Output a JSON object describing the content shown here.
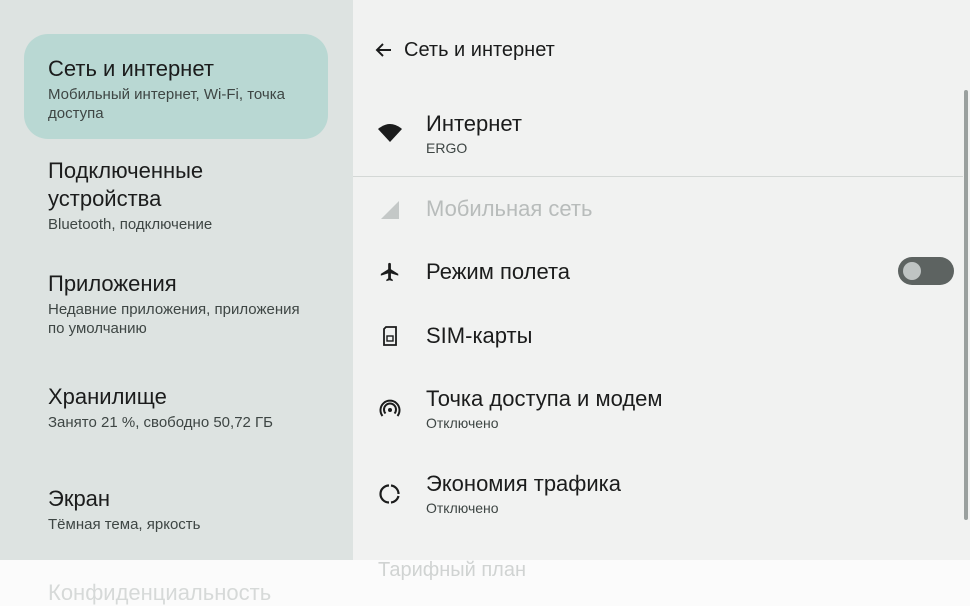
{
  "left_nav": {
    "items": [
      {
        "title": "Сеть и интернет",
        "subtitle": "Мобильный интернет, Wi-Fi, точка доступа"
      },
      {
        "title": "Подключенные устройства",
        "subtitle": "Bluetooth, подключение"
      },
      {
        "title": "Приложения",
        "subtitle": "Недавние приложения, приложения по умолчанию"
      },
      {
        "title": "Хранилище",
        "subtitle": "Занято 21 %, свободно 50,72 ГБ"
      },
      {
        "title": "Экран",
        "subtitle": "Тёмная тема, яркость"
      },
      {
        "title": "Конфиденциальность"
      }
    ]
  },
  "header": {
    "title": "Сеть и интернет"
  },
  "settings": {
    "internet": {
      "title": "Интернет",
      "subtitle": "ERGO",
      "icon": "wifi-icon"
    },
    "mobile": {
      "title": "Мобильная сеть",
      "icon": "signal-icon"
    },
    "airplane": {
      "title": "Режим полета",
      "icon": "airplane-icon",
      "toggle": "off"
    },
    "sim": {
      "title": "SIM-карты",
      "icon": "sim-card-icon"
    },
    "hotspot": {
      "title": "Точка доступа и модем",
      "subtitle": "Отключено",
      "icon": "hotspot-icon"
    },
    "datasaver": {
      "title": "Экономия трафика",
      "subtitle": "Отключено",
      "icon": "data-saver-icon"
    },
    "plan": {
      "title": "Тарифный план"
    }
  },
  "colors": {
    "left_bg": "#dde3e1",
    "selected_bg": "#b9d8d3",
    "right_bg": "#f1f2f1",
    "toggle_off": "#5d6361"
  }
}
